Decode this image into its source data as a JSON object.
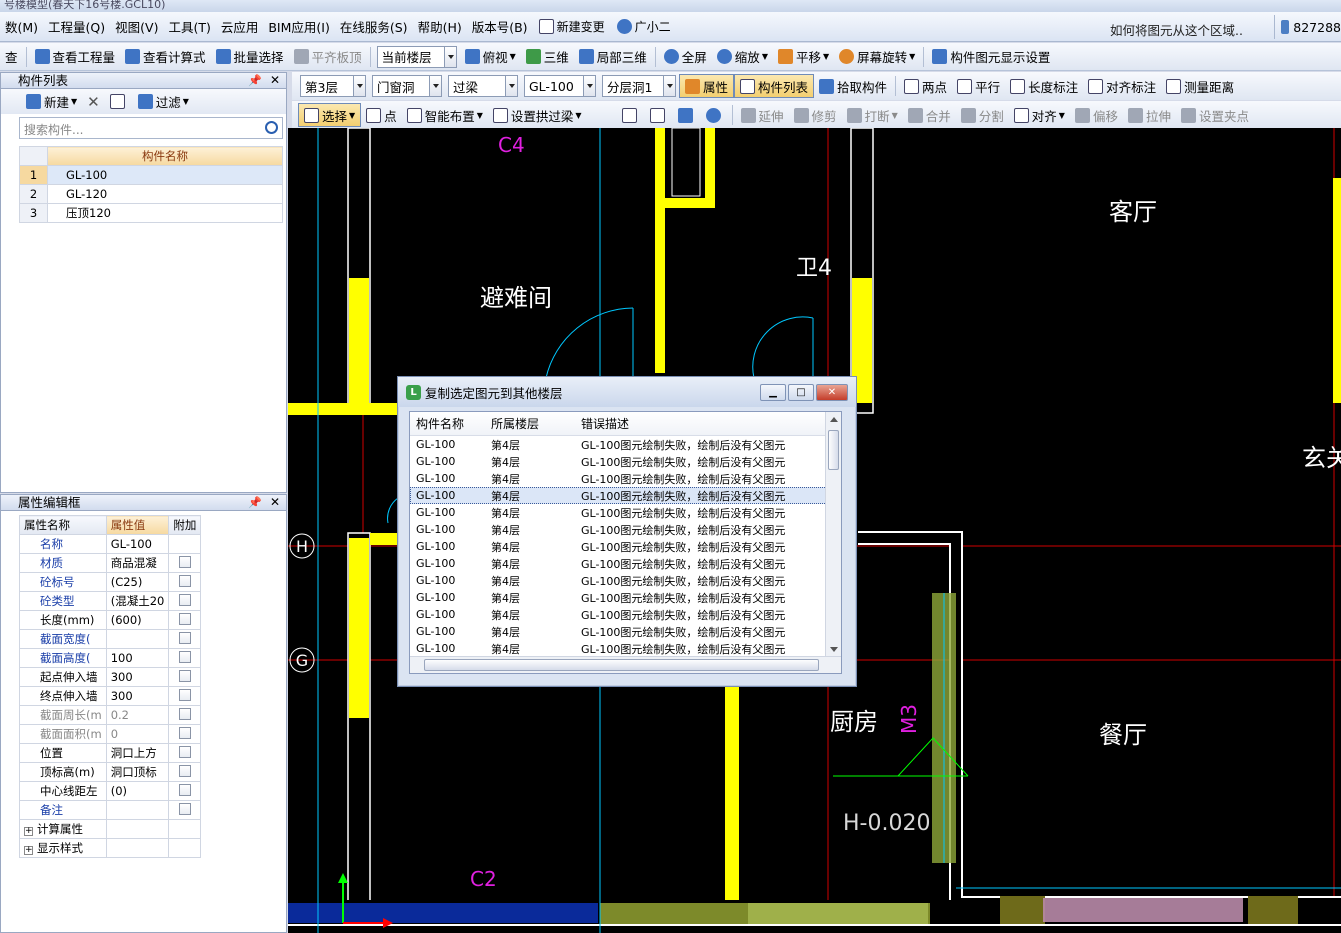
{
  "window": {
    "title": "号楼模型(春天下16号楼.GCL10)"
  },
  "menu": {
    "items": [
      "数(M)",
      "工程量(Q)",
      "视图(V)",
      "工具(T)",
      "云应用",
      "BIM应用(I)",
      "在线服务(S)",
      "帮助(H)",
      "版本号(B)"
    ],
    "new_change": "新建变更",
    "assistant": "广小二",
    "help_text": "如何将图元从这个区域..",
    "user_id": "827288"
  },
  "toolbar1": {
    "check": "查",
    "view_quantity": "查看工程量",
    "view_formula": "查看计算式",
    "batch_select": "批量选择",
    "flat_slab": "平齐板顶",
    "current_floor": "当前楼层",
    "top_view": "俯视",
    "three_d": "三维",
    "local_3d": "局部三维",
    "fullscreen": "全屏",
    "zoom": "缩放",
    "pan": "平移",
    "rotate": "屏幕旋转",
    "display_settings": "构件图元显示设置"
  },
  "toolbar2": {
    "floor": "第3层",
    "category": "门窗洞",
    "type": "过梁",
    "component": "GL-100",
    "layer": "分层洞1",
    "properties": "属性",
    "component_list": "构件列表",
    "pick": "拾取构件",
    "two_points": "两点",
    "parallel": "平行",
    "length_dim": "长度标注",
    "align_dim": "对齐标注",
    "measure": "测量距离"
  },
  "toolbar3": {
    "select": "选择",
    "point": "点",
    "smart_layout": "智能布置",
    "arch_beam": "设置拱过梁",
    "extend": "延伸",
    "trim": "修剪",
    "break": "打断",
    "merge": "合并",
    "split": "分割",
    "align": "对齐",
    "offset": "偏移",
    "stretch": "拉伸",
    "grip": "设置夹点"
  },
  "component_panel": {
    "title": "构件列表",
    "new_label": "新建",
    "filter_label": "过滤",
    "search_placeholder": "搜索构件...",
    "column_header": "构件名称",
    "rows": [
      {
        "num": "1",
        "name": "GL-100"
      },
      {
        "num": "2",
        "name": "GL-120"
      },
      {
        "num": "3",
        "name": "压顶120"
      }
    ]
  },
  "property_panel": {
    "title": "属性编辑框",
    "headers": {
      "name": "属性名称",
      "value": "属性值",
      "extra": "附加"
    },
    "rows": [
      {
        "name": "名称",
        "value": "GL-100"
      },
      {
        "name": "材质",
        "value": "商品混凝"
      },
      {
        "name": "砼标号",
        "value": "(C25)"
      },
      {
        "name": "砼类型",
        "value": "(混凝土20"
      },
      {
        "name": "长度(mm)",
        "value": "(600)"
      },
      {
        "name": "截面宽度(",
        "value": ""
      },
      {
        "name": "截面高度(",
        "value": "100"
      },
      {
        "name": "起点伸入墙",
        "value": "300"
      },
      {
        "name": "终点伸入墙",
        "value": "300"
      },
      {
        "name": "截面周长(m",
        "value": "0.2"
      },
      {
        "name": "截面面积(m",
        "value": "0"
      },
      {
        "name": "位置",
        "value": "洞口上方"
      },
      {
        "name": "顶标高(m)",
        "value": "洞口顶标"
      },
      {
        "name": "中心线距左",
        "value": "(0)"
      },
      {
        "name": "备注",
        "value": ""
      }
    ],
    "groups": [
      "计算属性",
      "显示样式"
    ]
  },
  "cad": {
    "rooms": [
      "避难间",
      "客厅",
      "厨房",
      "餐厅",
      "玄关",
      "卫4"
    ],
    "openings": [
      "C4",
      "C2",
      "M3"
    ],
    "axes": [
      "H",
      "G"
    ],
    "elevation": "H-0.020"
  },
  "dialog": {
    "title": "复制选定图元到其他楼层",
    "columns": [
      "构件名称",
      "所属楼层",
      "错误描述"
    ],
    "rows": [
      {
        "name": "GL-100",
        "floor": "第4层",
        "error": "GL-100图元绘制失败，绘制后没有父图元"
      },
      {
        "name": "GL-100",
        "floor": "第4层",
        "error": "GL-100图元绘制失败，绘制后没有父图元"
      },
      {
        "name": "GL-100",
        "floor": "第4层",
        "error": "GL-100图元绘制失败，绘制后没有父图元"
      },
      {
        "name": "GL-100",
        "floor": "第4层",
        "error": "GL-100图元绘制失败，绘制后没有父图元"
      },
      {
        "name": "GL-100",
        "floor": "第4层",
        "error": "GL-100图元绘制失败，绘制后没有父图元"
      },
      {
        "name": "GL-100",
        "floor": "第4层",
        "error": "GL-100图元绘制失败，绘制后没有父图元"
      },
      {
        "name": "GL-100",
        "floor": "第4层",
        "error": "GL-100图元绘制失败，绘制后没有父图元"
      },
      {
        "name": "GL-100",
        "floor": "第4层",
        "error": "GL-100图元绘制失败，绘制后没有父图元"
      },
      {
        "name": "GL-100",
        "floor": "第4层",
        "error": "GL-100图元绘制失败，绘制后没有父图元"
      },
      {
        "name": "GL-100",
        "floor": "第4层",
        "error": "GL-100图元绘制失败，绘制后没有父图元"
      },
      {
        "name": "GL-100",
        "floor": "第4层",
        "error": "GL-100图元绘制失败，绘制后没有父图元"
      },
      {
        "name": "GL-100",
        "floor": "第4层",
        "error": "GL-100图元绘制失败，绘制后没有父图元"
      },
      {
        "name": "GL-100",
        "floor": "第4层",
        "error": "GL-100图元绘制失败，绘制后没有父图元"
      }
    ]
  },
  "colors": {
    "wall_fill": "#ffff00",
    "grid_line": "#d00000",
    "outline": "#00c8ff",
    "label_magenta": "#e020e0",
    "beam_green": "#8fa83a"
  }
}
